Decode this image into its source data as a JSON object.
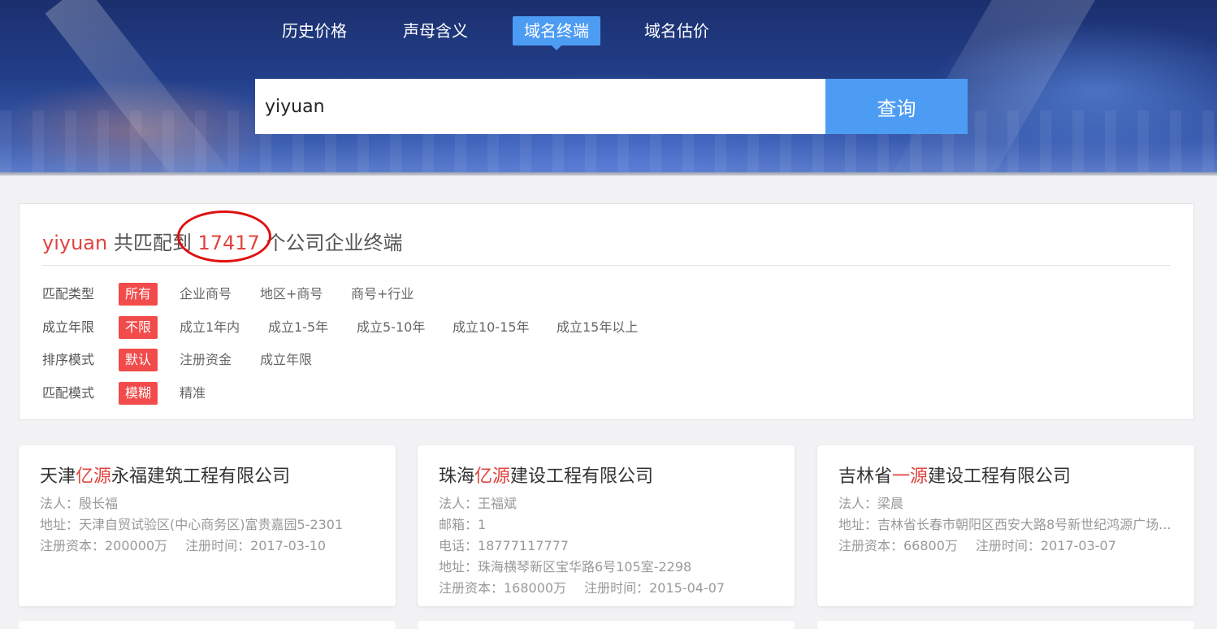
{
  "nav": {
    "tabs": [
      {
        "label": "历史价格"
      },
      {
        "label": "声母含义"
      },
      {
        "label": "域名终端",
        "active": true
      },
      {
        "label": "域名估价"
      }
    ]
  },
  "search": {
    "value": "yiyuan",
    "button_label": "查询"
  },
  "summary": {
    "keyword": "yiyuan",
    "prefix": " 共匹配到 ",
    "count": "17417",
    "suffix": " 个公司企业终端"
  },
  "filters": [
    {
      "label": "匹配类型",
      "options": [
        "所有",
        "企业商号",
        "地区+商号",
        "商号+行业"
      ],
      "active": 0
    },
    {
      "label": "成立年限",
      "options": [
        "不限",
        "成立1年内",
        "成立1-5年",
        "成立5-10年",
        "成立10-15年",
        "成立15年以上"
      ],
      "active": 0
    },
    {
      "label": "排序模式",
      "options": [
        "默认",
        "注册资金",
        "成立年限"
      ],
      "active": 0
    },
    {
      "label": "匹配模式",
      "options": [
        "模糊",
        "精准"
      ],
      "active": 0
    }
  ],
  "cards": [
    {
      "title_pre": "天津",
      "title_hl": "亿源",
      "title_post": "永福建筑工程有限公司",
      "legal": "法人：殷长福",
      "address": "地址：天津自贸试验区(中心商务区)富贵嘉园5-2301",
      "capital": "注册资本：200000万",
      "date": "注册时间：2017-03-10"
    },
    {
      "title_pre": "珠海",
      "title_hl": "亿源",
      "title_post": "建设工程有限公司",
      "legal": "法人：王福斌",
      "email": "邮箱：1",
      "phone": "电话：18777117777",
      "address": "地址：珠海横琴新区宝华路6号105室-2298",
      "capital": "注册资本：168000万",
      "date": "注册时间：2015-04-07"
    },
    {
      "title_pre": "吉林省",
      "title_hl": "一源",
      "title_post": "建设工程有限公司",
      "legal": "法人：梁晨",
      "address": "地址：吉林省长春市朝阳区西安大路8号新世纪鸿源广场...",
      "capital": "注册资本：66800万",
      "date": "注册时间：2017-03-07"
    }
  ],
  "colors": {
    "accent_blue": "#4d9cf3",
    "highlight_red": "#e0443e",
    "active_tag_red": "#f24b4b",
    "annotation_circle": "#e01010"
  }
}
